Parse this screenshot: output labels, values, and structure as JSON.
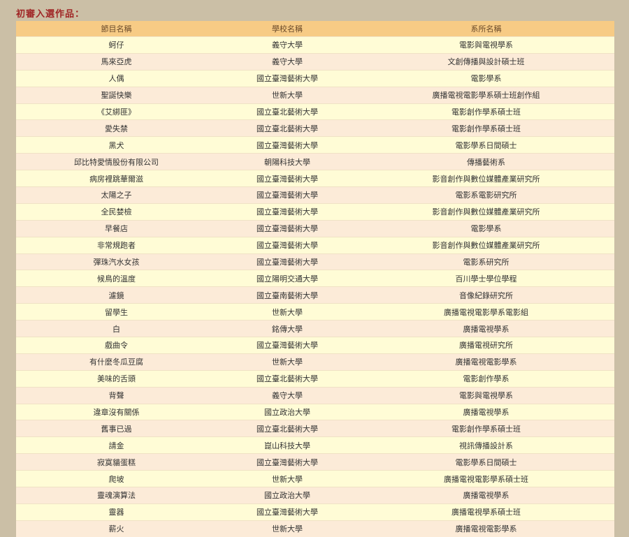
{
  "page": {
    "title": "初審入選作品："
  },
  "table": {
    "headers": [
      "節目名稱",
      "學校名稱",
      "系所名稱"
    ],
    "rows": [
      [
        "蚵仔",
        "義守大學",
        "電影與電視學系"
      ],
      [
        "馬來亞虎",
        "義守大學",
        "文創傳播與設計碩士班"
      ],
      [
        "人偶",
        "國立臺灣藝術大學",
        "電影學系"
      ],
      [
        "聖誕快樂",
        "世新大學",
        "廣播電視電影學系碩士班創作組"
      ],
      [
        "《艾綁匪》",
        "國立臺北藝術大學",
        "電影創作學系碩士班"
      ],
      [
        "愛失禁",
        "國立臺北藝術大學",
        "電影創作學系碩士班"
      ],
      [
        "黑犬",
        "國立臺灣藝術大學",
        "電影學系日間碩士"
      ],
      [
        "邱比特愛情股份有限公司",
        "朝陽科技大學",
        "傳播藝術系"
      ],
      [
        "病房裡跳華爾滋",
        "國立臺灣藝術大學",
        "影音創作與數位媒體產業研究所"
      ],
      [
        "太陽之子",
        "國立臺灣藝術大學",
        "電影系電影研究所"
      ],
      [
        "全民婪檢",
        "國立臺灣藝術大學",
        "影音創作與數位媒體產業研究所"
      ],
      [
        "早餐店",
        "國立臺灣藝術大學",
        "電影學系"
      ],
      [
        "非常規跑者",
        "國立臺灣藝術大學",
        "影音創作與數位媒體產業研究所"
      ],
      [
        "彈珠汽水女孩",
        "國立臺灣藝術大學",
        "電影系研究所"
      ],
      [
        "候鳥的溫度",
        "國立陽明交通大學",
        "百川學士學位學程"
      ],
      [
        "濾鏡",
        "國立臺南藝術大學",
        "音像紀錄研究所"
      ],
      [
        "留學生",
        "世新大學",
        "廣播電視電影學系電影組"
      ],
      [
        "白",
        "銘傳大學",
        "廣播電視學系"
      ],
      [
        "戲曲令",
        "國立臺灣藝術大學",
        "廣播電視研究所"
      ],
      [
        "有什麼冬瓜豆腐",
        "世新大學",
        "廣播電視電影學系"
      ],
      [
        "美味的舌頭",
        "國立臺北藝術大學",
        "電影創作學系"
      ],
      [
        "背聲",
        "義守大學",
        "電影與電視學系"
      ],
      [
        "違章沒有關係",
        "國立政治大學",
        "廣播電視學系"
      ],
      [
        "舊事已過",
        "國立臺北藝術大學",
        "電影創作學系碩士班"
      ],
      [
        "請金",
        "崑山科技大學",
        "視訊傳播設計系"
      ],
      [
        "寂寞貓蛋糕",
        "國立臺灣藝術大學",
        "電影學系日間碩士"
      ],
      [
        "爬坡",
        "世新大學",
        "廣播電視電影學系碩士班"
      ],
      [
        "靈魂演算法",
        "國立政治大學",
        "廣播電視學系"
      ],
      [
        "靈器",
        "國立臺灣藝術大學",
        "廣播電視學系碩士班"
      ],
      [
        "薪火",
        "世新大學",
        "廣播電視電影學系"
      ]
    ]
  }
}
